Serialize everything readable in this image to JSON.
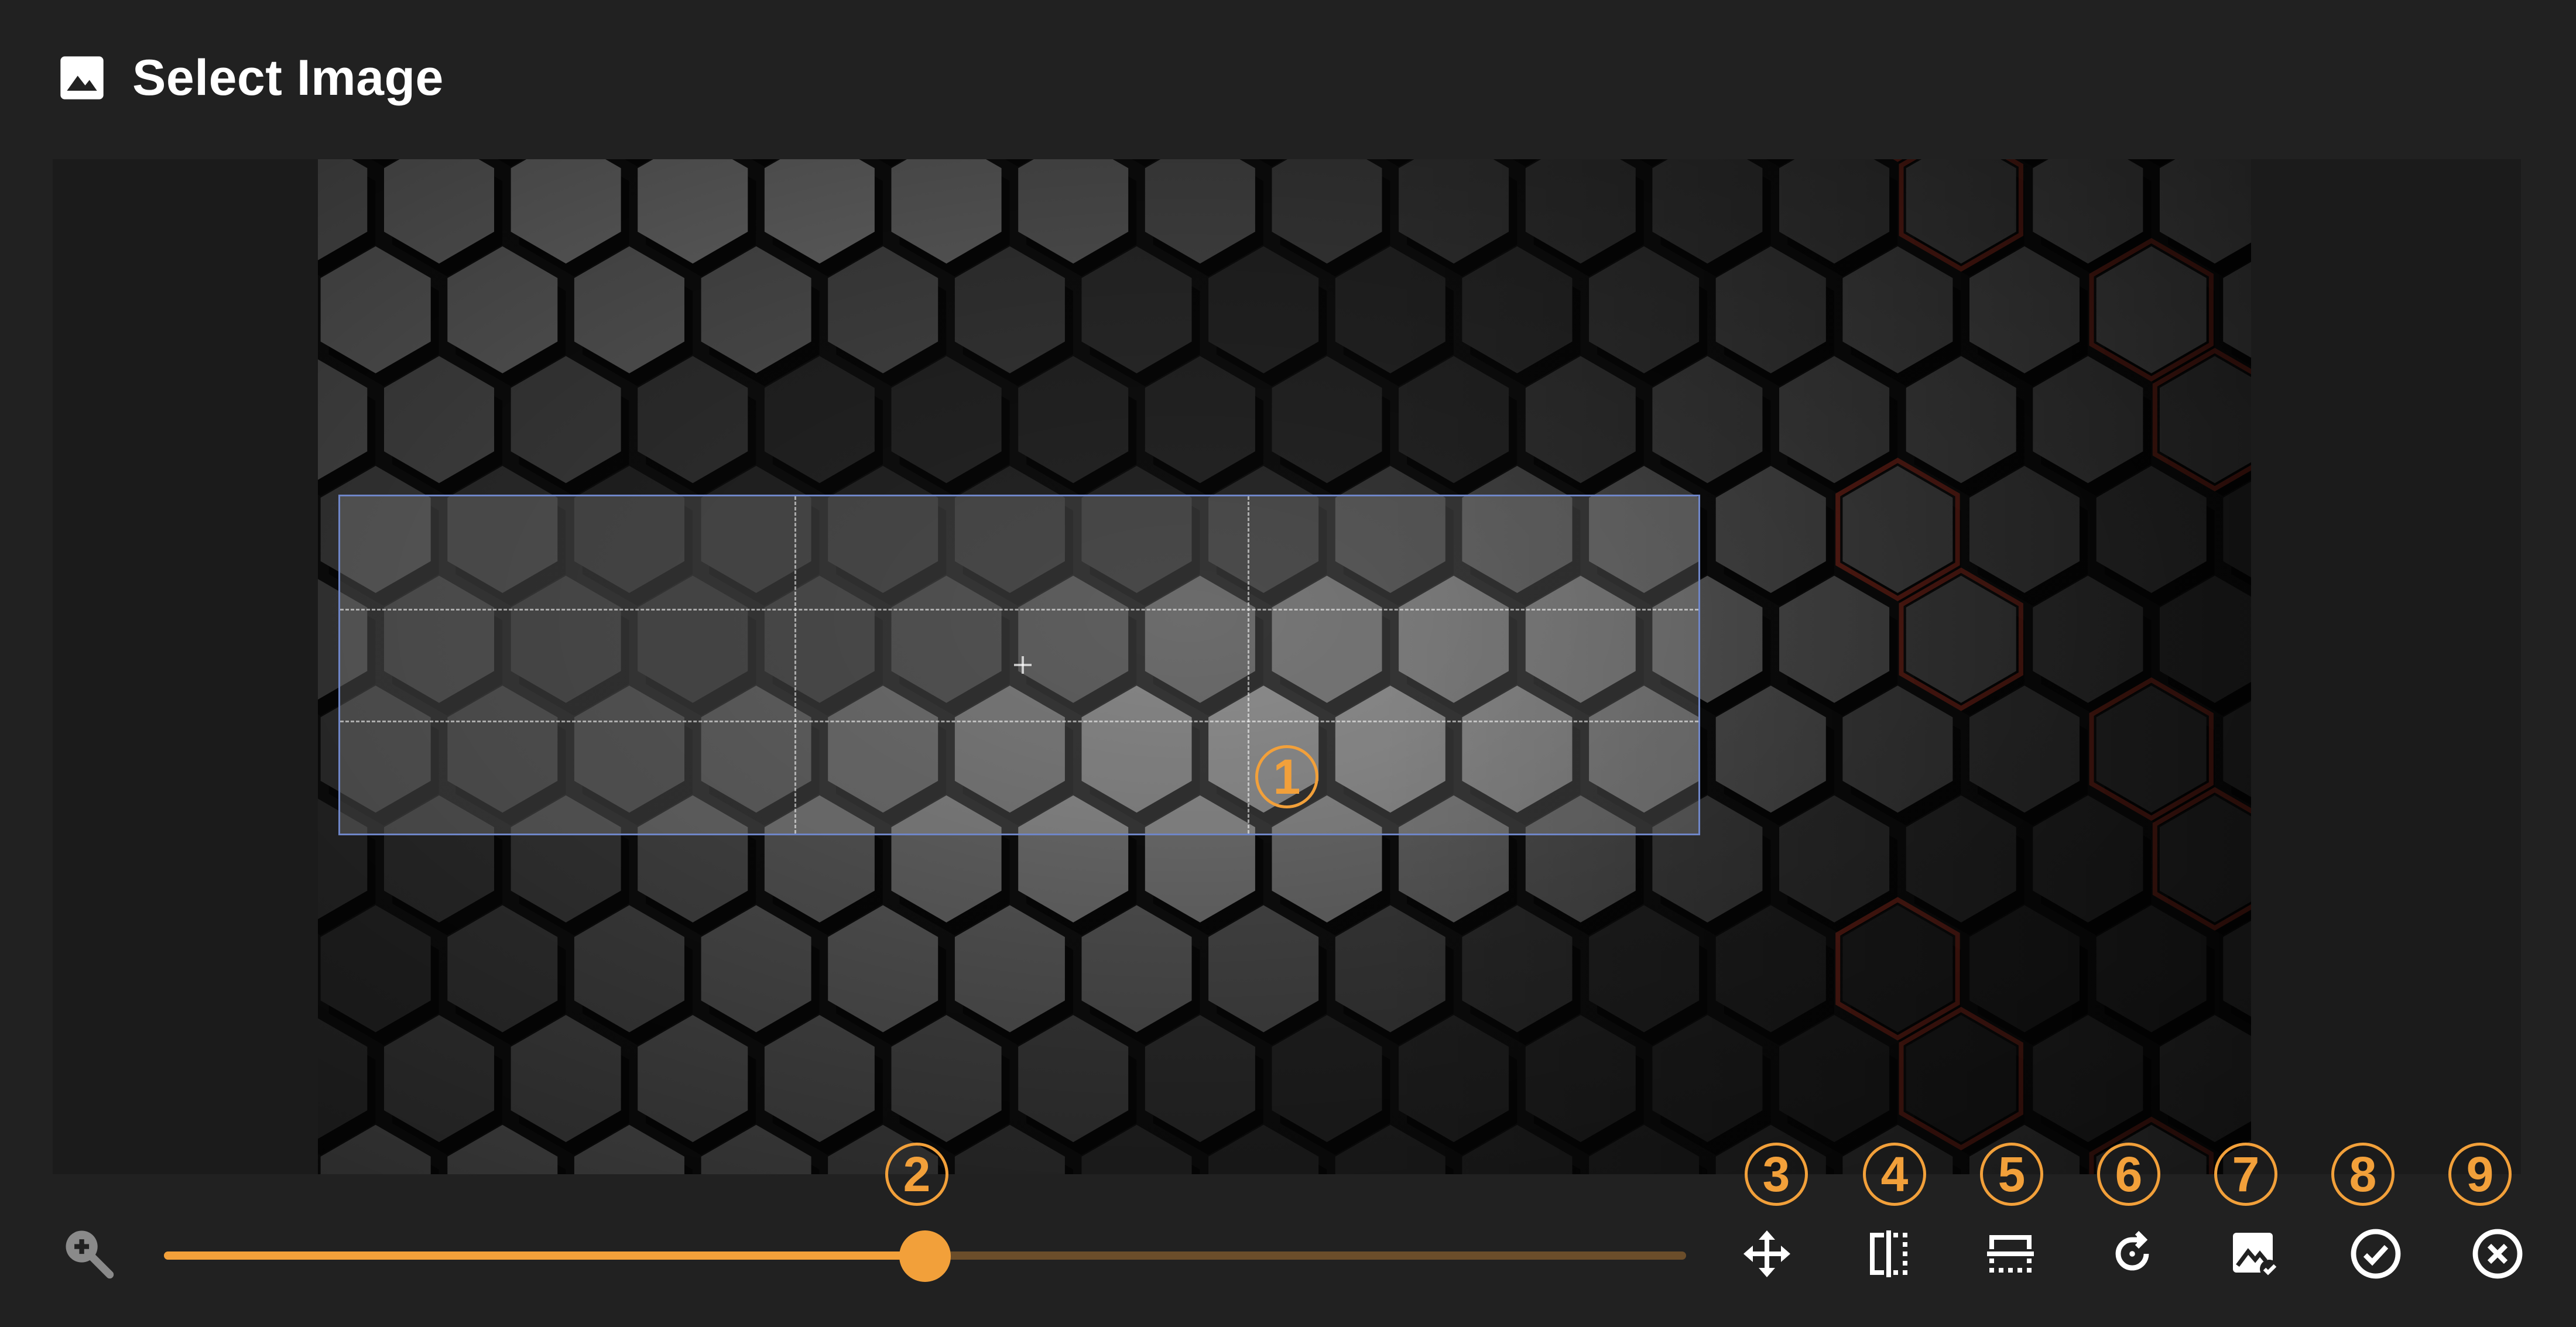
{
  "header": {
    "title": "Select Image",
    "icon": "image-icon"
  },
  "markers": [
    "1",
    "2",
    "3",
    "4",
    "5",
    "6",
    "7",
    "8",
    "9"
  ],
  "zoom": {
    "icon": "zoom-in-icon",
    "level": 0.5
  },
  "toolbar": [
    {
      "name": "move-icon"
    },
    {
      "name": "flip-horizontal-icon"
    },
    {
      "name": "flip-vertical-icon"
    },
    {
      "name": "rotate-icon"
    },
    {
      "name": "image-check-icon"
    },
    {
      "name": "confirm-icon"
    },
    {
      "name": "cancel-icon"
    }
  ],
  "colors": {
    "background": "#212121",
    "accent": "#f2a03a",
    "crop_border": "#6f86c8",
    "glow": "#d8402a"
  }
}
